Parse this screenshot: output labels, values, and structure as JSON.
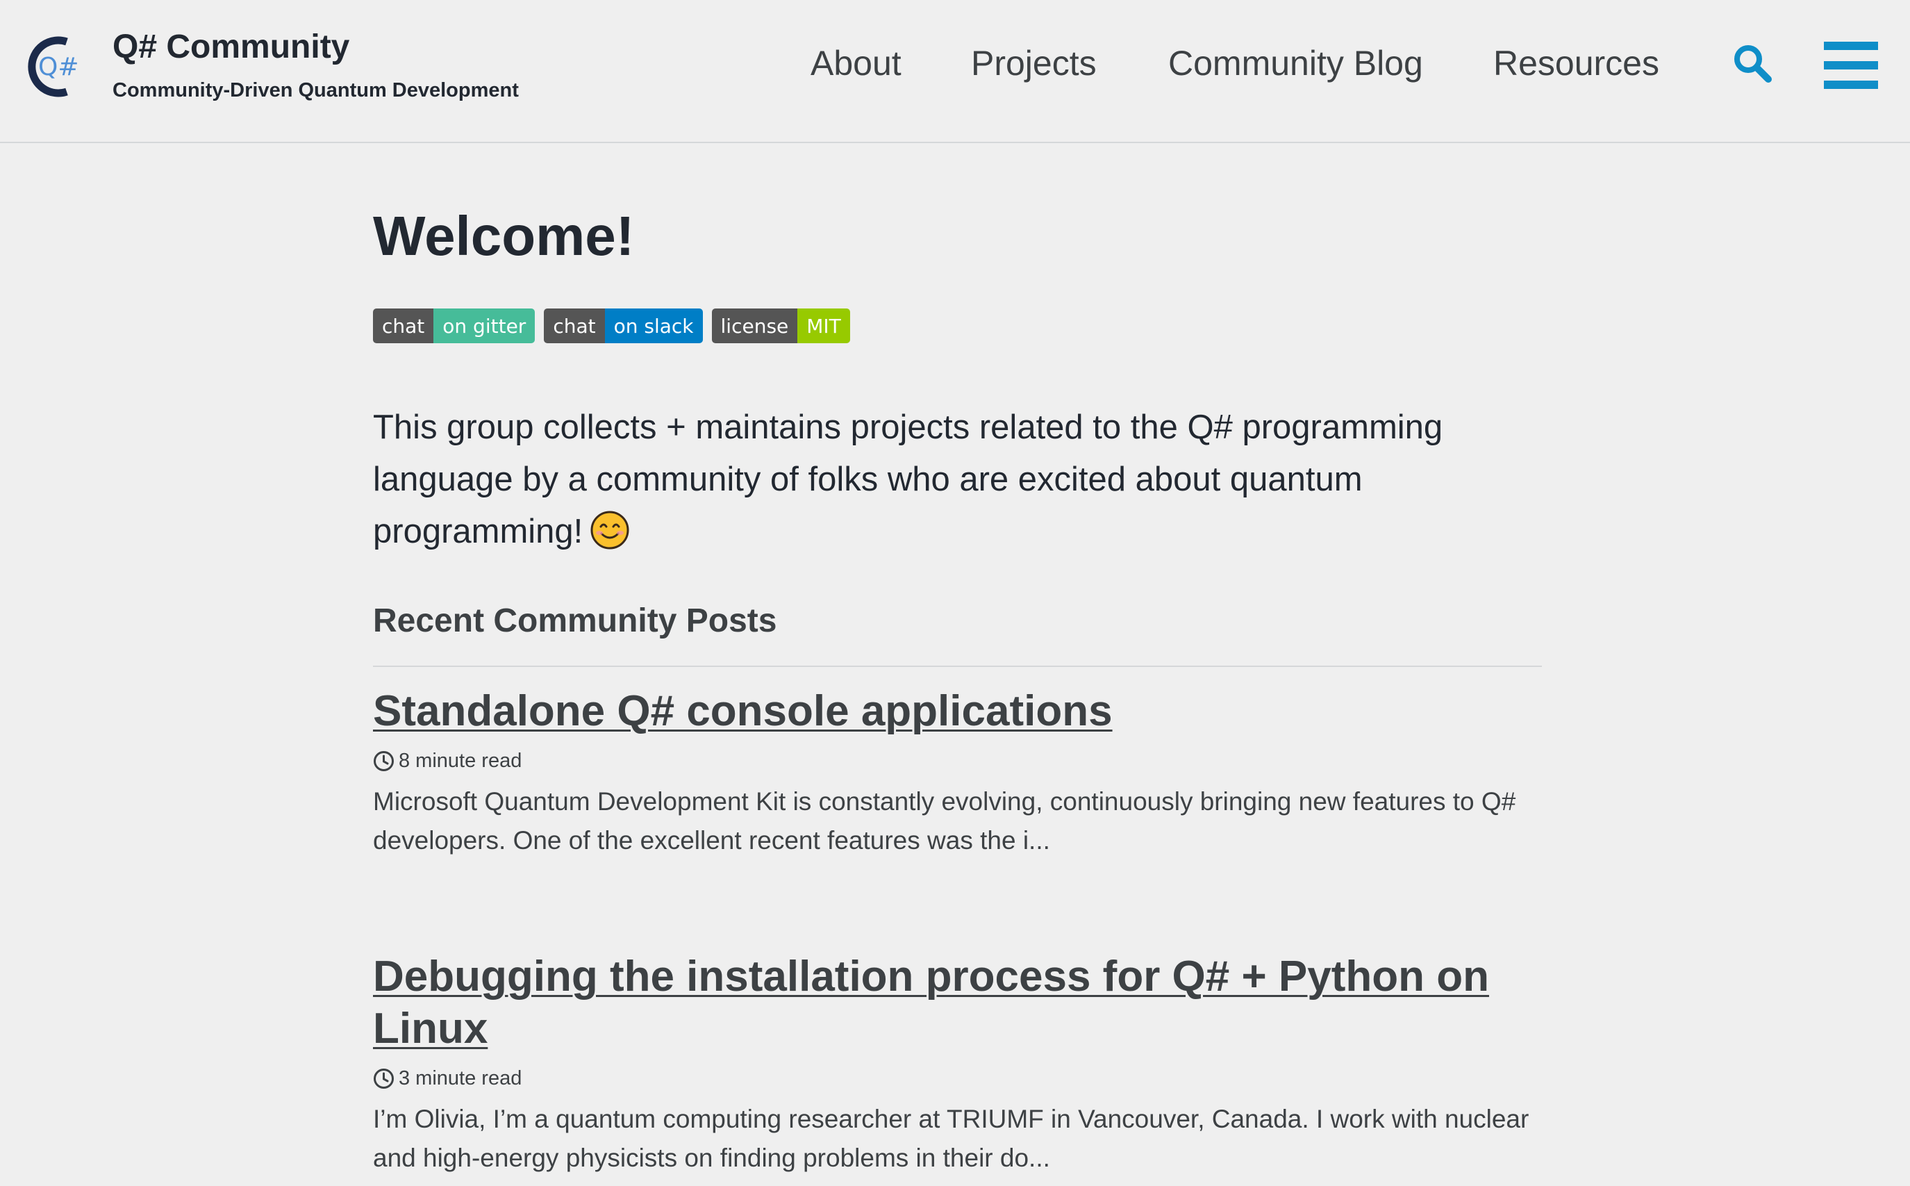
{
  "header": {
    "logo_text": "Q#",
    "title": "Q# Community",
    "subtitle": "Community-Driven Quantum Development",
    "nav": [
      {
        "label": "About"
      },
      {
        "label": "Projects"
      },
      {
        "label": "Community Blog"
      },
      {
        "label": "Resources"
      }
    ],
    "search_icon": "search-icon",
    "menu_icon": "hamburger-menu-icon"
  },
  "main": {
    "heading": "Welcome!",
    "badges": [
      {
        "left": "chat",
        "right": "on gitter",
        "color": "#46bc99"
      },
      {
        "left": "chat",
        "right": "on slack",
        "color": "#007ec6"
      },
      {
        "left": "license",
        "right": "MIT",
        "color": "#97ca00"
      }
    ],
    "intro": "This group collects + maintains projects related to the Q# programming language by a community of folks who are excited about quantum programming!",
    "intro_emoji": "smiling-face-icon",
    "recent_title": "Recent Community Posts",
    "posts": [
      {
        "title": "Standalone Q# console applications",
        "read_time": "8 minute read",
        "excerpt": "Microsoft Quantum Development Kit is constantly evolving, continuously bringing new features to Q# developers. One of the excellent recent features was the i..."
      },
      {
        "title": "Debugging the installation process for Q# + Python on Linux",
        "read_time": "3 minute read",
        "excerpt": "I’m Olivia, I’m a quantum computing researcher at TRIUMF in Vancouver, Canada. I work with nuclear and high-energy physicists on finding problems in their do..."
      }
    ]
  },
  "colors": {
    "accent": "#0f8ec8",
    "text": "#222831",
    "muted_text": "#3d4144",
    "background": "#efefef",
    "logo_dark": "#1b2a4a",
    "logo_blue": "#4f8fd6"
  }
}
